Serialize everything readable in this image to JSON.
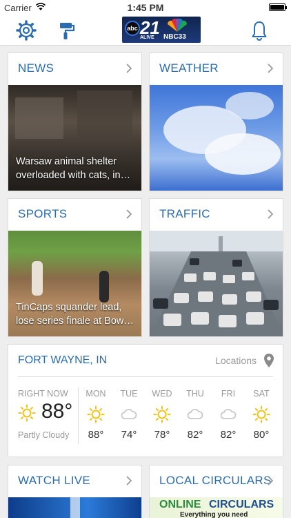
{
  "status": {
    "carrier": "Carrier",
    "time": "1:45 PM"
  },
  "logo": {
    "abc": "abc",
    "num": "21",
    "alive": "ALIVE",
    "nbc": "NBC33"
  },
  "cards": {
    "news": {
      "title": "NEWS",
      "caption": "Warsaw animal shelter overloaded with cats, in…"
    },
    "weather": {
      "title": "WEATHER"
    },
    "sports": {
      "title": "SPORTS",
      "caption": "TinCaps squander lead, lose series finale at Bow…"
    },
    "traffic": {
      "title": "TRAFFIC"
    },
    "watch_live": {
      "title": "WATCH LIVE"
    },
    "circulars": {
      "title": "LOCAL CIRCULARS",
      "banner_1": "ONLINE",
      "banner_2": "CIRCULARS",
      "banner_sub": "Everything you need"
    }
  },
  "forecast": {
    "city": "FORT WAYNE, IN",
    "locations_label": "Locations",
    "now": {
      "label": "RIGHT NOW",
      "temp": "88°",
      "condition": "Partly Cloudy",
      "icon": "sun-icon"
    },
    "days": [
      {
        "name": "MON",
        "temp": "88°",
        "icon": "sun-icon"
      },
      {
        "name": "TUE",
        "temp": "74°",
        "icon": "cloud-icon"
      },
      {
        "name": "WED",
        "temp": "78°",
        "icon": "sun-icon"
      },
      {
        "name": "THU",
        "temp": "82°",
        "icon": "cloud-icon"
      },
      {
        "name": "FRI",
        "temp": "82°",
        "icon": "cloud-icon"
      },
      {
        "name": "SAT",
        "temp": "80°",
        "icon": "sun-icon"
      }
    ]
  },
  "colors": {
    "accent": "#2b6cb0",
    "sun": "#f2c21b",
    "cloud": "#c9c9c9"
  }
}
